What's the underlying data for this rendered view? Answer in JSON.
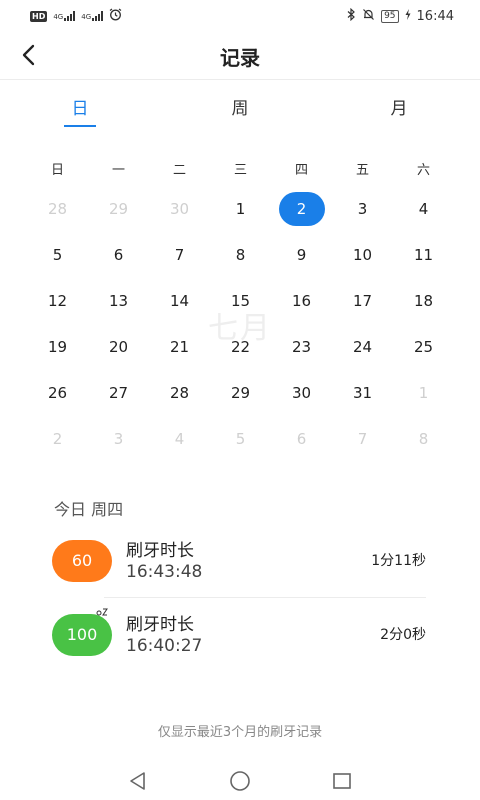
{
  "status_bar": {
    "hd": "HD",
    "net1": "4G",
    "net2": "4G",
    "battery": "95",
    "time": "16:44"
  },
  "header": {
    "title": "记录"
  },
  "tabs": [
    {
      "label": "日",
      "active": true
    },
    {
      "label": "周",
      "active": false
    },
    {
      "label": "月",
      "active": false
    }
  ],
  "calendar": {
    "weekdays": [
      "日",
      "一",
      "二",
      "三",
      "四",
      "五",
      "六"
    ],
    "watermark": "七月",
    "selected": "2",
    "weeks": [
      [
        {
          "d": "28",
          "other": true
        },
        {
          "d": "29",
          "other": true
        },
        {
          "d": "30",
          "other": true
        },
        {
          "d": "1"
        },
        {
          "d": "2",
          "sel": true
        },
        {
          "d": "3"
        },
        {
          "d": "4"
        }
      ],
      [
        {
          "d": "5"
        },
        {
          "d": "6"
        },
        {
          "d": "7"
        },
        {
          "d": "8"
        },
        {
          "d": "9"
        },
        {
          "d": "10"
        },
        {
          "d": "11"
        }
      ],
      [
        {
          "d": "12"
        },
        {
          "d": "13"
        },
        {
          "d": "14"
        },
        {
          "d": "15"
        },
        {
          "d": "16"
        },
        {
          "d": "17"
        },
        {
          "d": "18"
        }
      ],
      [
        {
          "d": "19"
        },
        {
          "d": "20"
        },
        {
          "d": "21"
        },
        {
          "d": "22"
        },
        {
          "d": "23"
        },
        {
          "d": "24"
        },
        {
          "d": "25"
        }
      ],
      [
        {
          "d": "26"
        },
        {
          "d": "27"
        },
        {
          "d": "28"
        },
        {
          "d": "29"
        },
        {
          "d": "30"
        },
        {
          "d": "31"
        },
        {
          "d": "1",
          "other": true
        }
      ],
      [
        {
          "d": "2",
          "other": true
        },
        {
          "d": "3",
          "other": true
        },
        {
          "d": "4",
          "other": true
        },
        {
          "d": "5",
          "other": true
        },
        {
          "d": "6",
          "other": true
        },
        {
          "d": "7",
          "other": true
        },
        {
          "d": "8",
          "other": true
        }
      ]
    ]
  },
  "records": {
    "section_title": "今日 周四",
    "items": [
      {
        "score": "60",
        "label": "刷牙时长",
        "time": "16:43:48",
        "duration": "1分11秒",
        "color": "#ff7a1a"
      },
      {
        "score": "100",
        "label": "刷牙时长",
        "time": "16:40:27",
        "duration": "2分0秒",
        "color": "#49c245"
      }
    ]
  },
  "footer_note": "仅显示最近3个月的刷牙记录",
  "colors": {
    "accent": "#1a7fe8"
  },
  "icons": {
    "back": "chevron-left-icon",
    "nav_back": "triangle-back-icon",
    "nav_home": "circle-home-icon",
    "nav_recent": "square-recent-icon"
  }
}
